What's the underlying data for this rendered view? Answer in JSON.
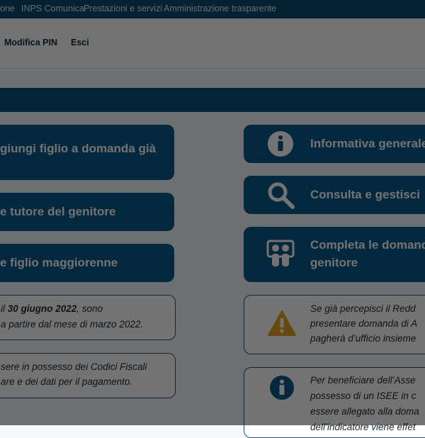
{
  "topnav": {
    "item0": "one",
    "item1": "INPS Comunica",
    "item2": "Prestazioni e servizi",
    "item3": "Amministrazione trasparente"
  },
  "subnav": {
    "modifica_pin": "Modifica PIN",
    "esci": "Esci"
  },
  "left_buttons": [
    {
      "line1": "giungi figlio a domanda già"
    },
    {
      "line1": "e tutore del genitore"
    },
    {
      "line1": "e figlio maggiorenne"
    }
  ],
  "right_buttons": [
    {
      "line1": "Informativa generale"
    },
    {
      "line1": "Consulta e gestisci"
    },
    {
      "line1": "Completa le domand",
      "line2": "genitore"
    }
  ],
  "left_notes": [
    {
      "l1_prefix": "il ",
      "l1_bold": "30 giugno 2022",
      "l1_suffix": ", sono",
      "l2": "a partire dal mese di marzo 2022."
    },
    {
      "l1": "sere in possesso dei Codici Fiscali",
      "l2": "are e dei dati per il pagamento."
    }
  ],
  "right_notes": [
    {
      "l1": "Se già percepisci il Redd",
      "l2": "presentare domanda di A",
      "l3": "pagherà d’ufficio insieme"
    },
    {
      "l1": "Per beneficiare dell’Asse",
      "l2": "possesso di un ISEE in c",
      "l3": "essere allegato alla doma",
      "l4": "dell’indicatore viene effet"
    }
  ],
  "colors": {
    "topbar": "#0a4a6e",
    "button": "#0b5a8a",
    "warning": "#e7a31d"
  },
  "icons": [
    "info-icon",
    "search-icon",
    "family-icon",
    "warning-icon",
    "info-icon"
  ]
}
